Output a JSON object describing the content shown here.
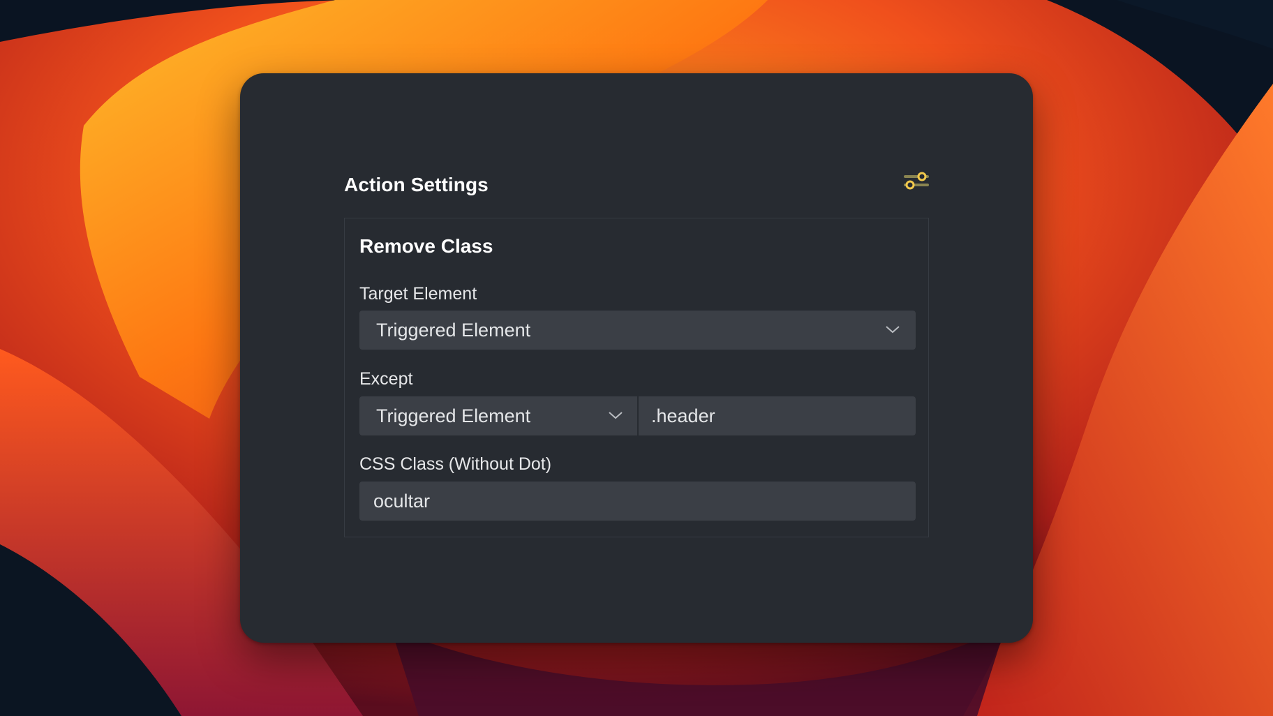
{
  "panel": {
    "title": "Action Settings",
    "settings_icon": "sliders-icon",
    "accent_color": "#f2c94c"
  },
  "action": {
    "name": "Remove Class",
    "target_element": {
      "label": "Target Element",
      "value": "Triggered Element"
    },
    "except": {
      "label": "Except",
      "select_value": "Triggered Element",
      "input_value": ".header"
    },
    "css_class": {
      "label": "CSS Class (Without Dot)",
      "value": "ocultar"
    }
  }
}
